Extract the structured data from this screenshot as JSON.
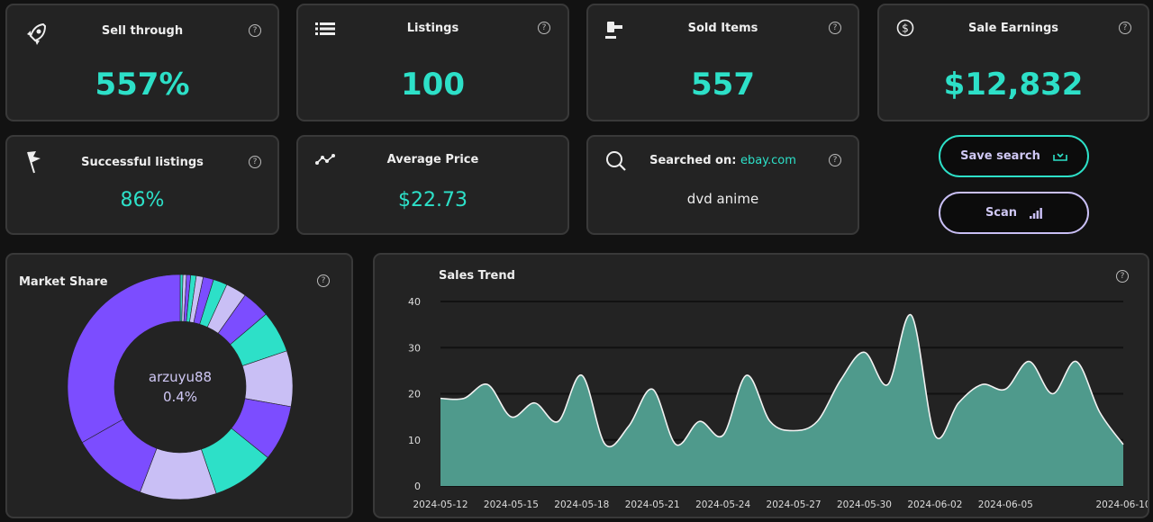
{
  "colors": {
    "accent": "#2de0c8",
    "purple": "#7c4dff",
    "lavender": "#c9bff5",
    "area": "#4f9a8c"
  },
  "stats": [
    {
      "label": "Sell through",
      "value": "557%",
      "icon": "rocket-icon"
    },
    {
      "label": "Listings",
      "value": "100",
      "icon": "list-icon"
    },
    {
      "label": "Sold Items",
      "value": "557",
      "icon": "gavel-icon"
    },
    {
      "label": "Sale Earnings",
      "value": "$12,832",
      "icon": "dollar-circle-icon"
    },
    {
      "label": "Successful listings",
      "value": "86%",
      "icon": "flag-icon"
    },
    {
      "label": "Average Price",
      "value": "$22.73",
      "icon": "trend-icon"
    }
  ],
  "search": {
    "label": "Searched on:",
    "site": "ebay.com",
    "query": "dvd anime"
  },
  "buttons": {
    "save": "Save search",
    "scan": "Scan"
  },
  "help": "?",
  "market_share": {
    "title": "Market Share",
    "center_name": "arzuyu88",
    "center_value": "0.4%"
  },
  "chart_data": [
    {
      "type": "pie",
      "title": "Market Share",
      "donut": true,
      "values": [
        0.4,
        0.5,
        0.6,
        0.8,
        1,
        1.5,
        2,
        3,
        4,
        6,
        8,
        8,
        9,
        11,
        11,
        33.2
      ]
    },
    {
      "type": "area",
      "title": "Sales Trend",
      "ylim": [
        0,
        40
      ],
      "yticks": [
        0,
        10,
        20,
        30,
        40
      ],
      "grid": true,
      "xtick_labels": [
        "2024-05-12",
        "2024-05-15",
        "2024-05-18",
        "2024-05-21",
        "2024-05-24",
        "2024-05-27",
        "2024-05-30",
        "2024-06-02",
        "2024-06-05",
        "2024-06-10"
      ],
      "x": [
        "2024-05-12",
        "2024-05-13",
        "2024-05-14",
        "2024-05-15",
        "2024-05-16",
        "2024-05-17",
        "2024-05-18",
        "2024-05-19",
        "2024-05-20",
        "2024-05-21",
        "2024-05-22",
        "2024-05-23",
        "2024-05-24",
        "2024-05-25",
        "2024-05-26",
        "2024-05-27",
        "2024-05-28",
        "2024-05-29",
        "2024-05-30",
        "2024-05-31",
        "2024-06-01",
        "2024-06-02",
        "2024-06-03",
        "2024-06-04",
        "2024-06-05",
        "2024-06-06",
        "2024-06-07",
        "2024-06-08",
        "2024-06-09",
        "2024-06-10"
      ],
      "y": [
        19,
        19,
        22,
        15,
        18,
        14,
        24,
        9,
        13,
        21,
        9,
        14,
        11,
        24,
        14,
        12,
        14,
        23,
        29,
        22,
        37,
        11,
        18,
        22,
        21,
        27,
        20,
        27,
        16,
        9
      ]
    }
  ]
}
